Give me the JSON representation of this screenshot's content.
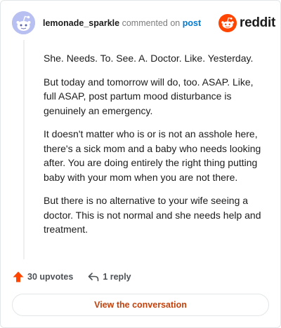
{
  "comment": {
    "username": "lemonade_sparkle",
    "action_text": "commented on",
    "target_link": "post",
    "avatar_icon": "reddit-snoo-avatar-icon",
    "paragraphs": [
      "She. Needs. To. See. A. Doctor. Like. Yesterday.",
      "But today and tomorrow will do, too. ASAP. Like, full ASAP, post partum mood disturbance is genuinely an emergency.",
      "It doesn't matter who is or is not an asshole here, there's a sick mom and a baby who needs looking after. You are doing entirely the right thing putting baby with your mom when you are not there.",
      "But there is no alternative to your wife seeing a doctor. This is not normal and she needs help and treatment."
    ]
  },
  "brand": {
    "name": "reddit",
    "logo_icon": "reddit-logo-icon",
    "accent_color": "#ff4500"
  },
  "actions": {
    "upvotes_label": "30 upvotes",
    "upvote_icon": "upvote-arrow-icon",
    "upvote_color": "#ff4500",
    "replies_label": "1 reply",
    "reply_icon": "reply-arrow-icon"
  },
  "footer": {
    "button_label": "View the conversation",
    "button_color": "#c2410c"
  }
}
